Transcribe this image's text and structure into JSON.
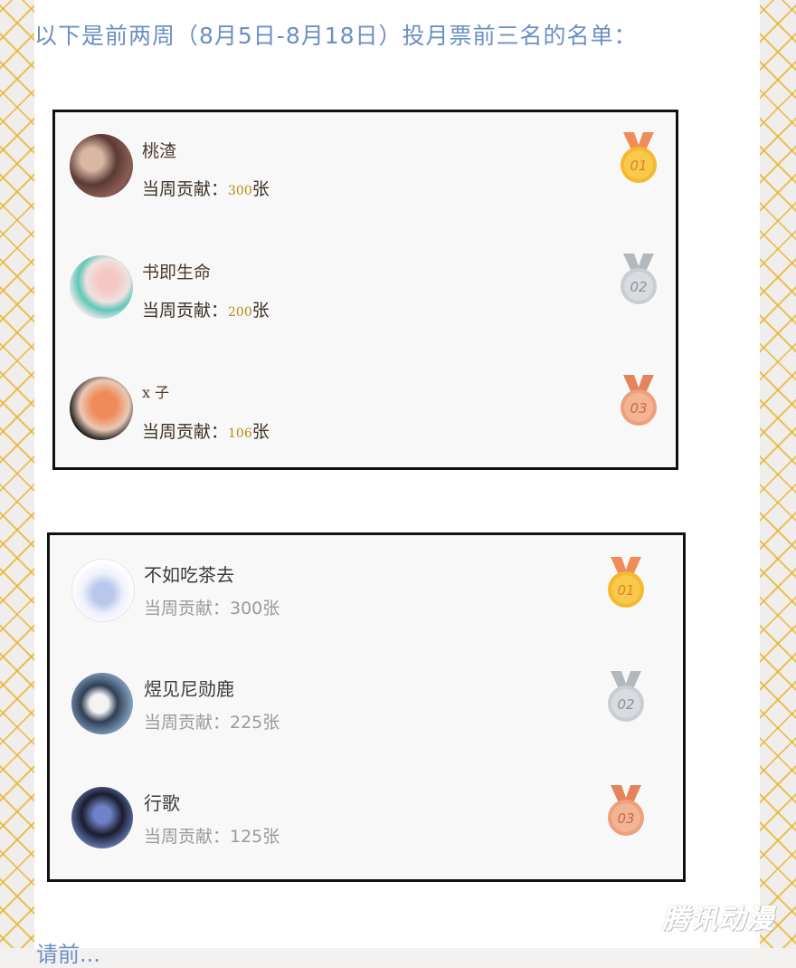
{
  "heading": "以下是前两周（8月5日-8月18日）投月票前三名的名单：",
  "list1": {
    "rows": [
      {
        "name": "桃渣",
        "label": "当周贡献：",
        "value": "300",
        "unit": "张",
        "medal": "01",
        "medal_color": "#f5b82e"
      },
      {
        "name": "书即生命",
        "label": "当周贡献：",
        "value": "200",
        "unit": "张",
        "medal": "02",
        "medal_color": "#c8cdd2"
      },
      {
        "name": "x 子",
        "label": "当周贡献：",
        "value": "106",
        "unit": "张",
        "medal": "03",
        "medal_color": "#eda07c"
      }
    ]
  },
  "list2": {
    "rows": [
      {
        "name": "不如吃茶去",
        "contribution": "当周贡献：300张",
        "medal": "01",
        "medal_color": "#f5b82e"
      },
      {
        "name": "煜见尼勋鹿",
        "contribution": "当周贡献：225张",
        "medal": "02",
        "medal_color": "#c8cdd2"
      },
      {
        "name": "行歌",
        "contribution": "当周贡献：125张",
        "medal": "03",
        "medal_color": "#eda07c"
      }
    ]
  },
  "footer": "请前...",
  "watermark": "腾讯动漫",
  "colors": {
    "heading": "#6b8fc5",
    "gold": "#f5b82e",
    "silver": "#c8cdd2",
    "bronze": "#eda07c"
  }
}
